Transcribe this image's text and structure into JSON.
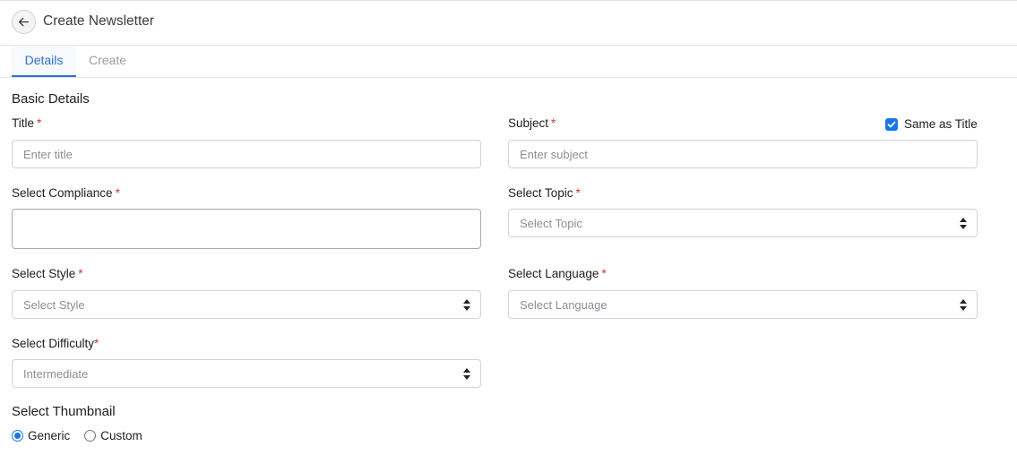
{
  "header": {
    "title": "Create Newsletter",
    "back_icon": "arrow-left-icon"
  },
  "tabs": [
    {
      "label": "Details",
      "active": true
    },
    {
      "label": "Create",
      "active": false
    }
  ],
  "basic_details": {
    "heading": "Basic Details",
    "required_mark": "*",
    "title": {
      "label": "Title",
      "value": "",
      "placeholder": "Enter title"
    },
    "subject": {
      "label": "Subject",
      "value": "",
      "placeholder": "Enter subject"
    },
    "same_as_title": {
      "label": "Same as Title",
      "checked": true
    },
    "compliance": {
      "label": "Select Compliance",
      "value": ""
    },
    "topic": {
      "label": "Select Topic",
      "value": "Select Topic"
    },
    "style": {
      "label": "Select Style",
      "value": "Select Style"
    },
    "language": {
      "label": "Select Language",
      "value": "Select Language"
    },
    "difficulty": {
      "label": "Select Difficulty",
      "value": "Intermediate"
    }
  },
  "thumbnail": {
    "heading": "Select Thumbnail",
    "options": [
      {
        "label": "Generic",
        "selected": true
      },
      {
        "label": "Custom",
        "selected": false
      }
    ]
  },
  "colors": {
    "accent": "#2f6fd2",
    "checkbox": "#1a73e8",
    "required": "#d9322b"
  }
}
